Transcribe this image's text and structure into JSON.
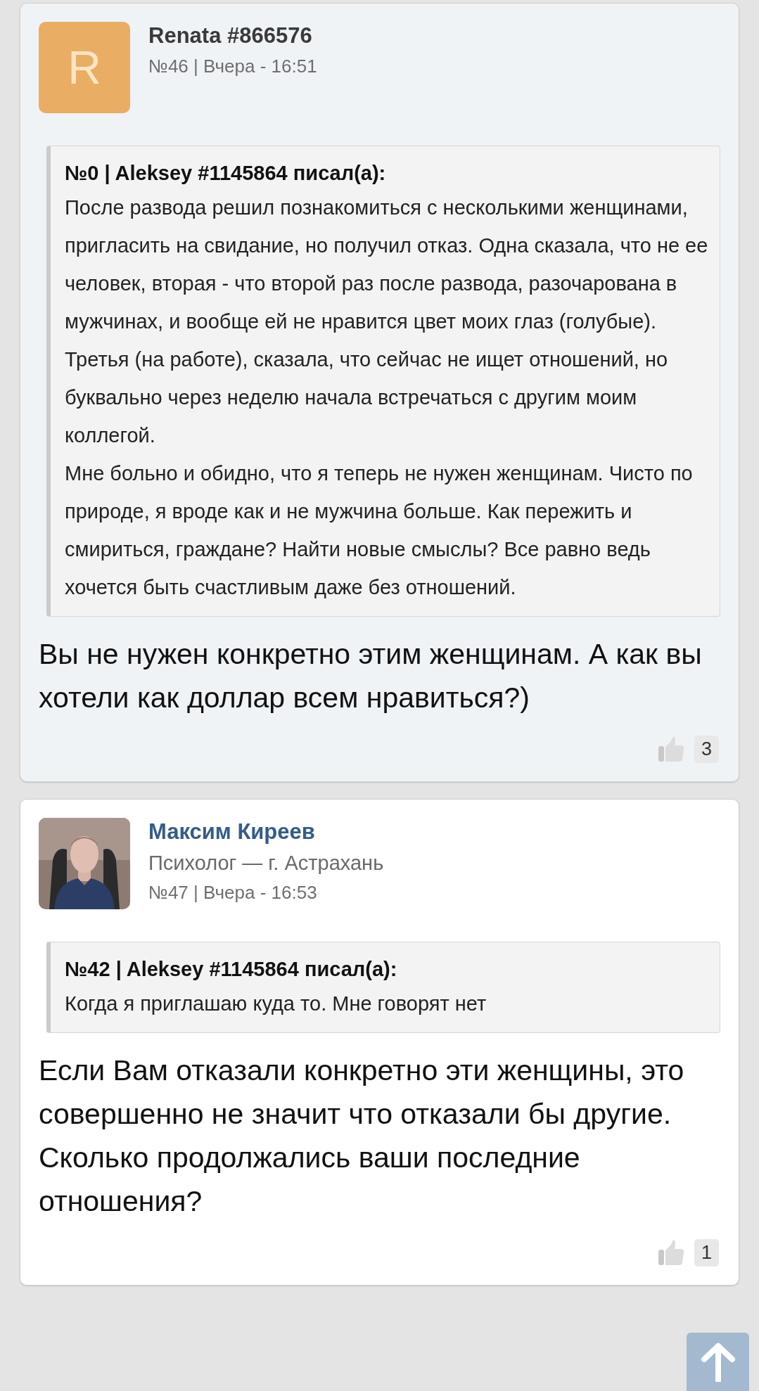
{
  "posts": [
    {
      "highlighted": true,
      "name_is_link": false,
      "avatar": {
        "kind": "letter",
        "letter": "R"
      },
      "name": "Renata #866576",
      "meta": "№46 | Вчера - 16:51",
      "quote": {
        "header": "№0 | Aleksey #1145864 писал(а):",
        "paragraphs": [
          "После развода решил познакомиться с несколькими женщинами, пригласить на свидание, но получил отказ. Одна сказала, что не ее человек, вторая - что второй раз после развода, разочарована в мужчинах, и вообще ей не нравится цвет моих глаз (голубые). Третья (на работе), сказала, что сейчас не ищет отношений, но буквально через неделю начала встречаться с другим моим коллегой.",
          "Мне больно и обидно, что я теперь не нужен женщинам. Чисто по природе, я вроде как и не мужчина больше. Как пережить и смириться, граждане? Найти новые смыслы? Все равно ведь хочется быть счастливым даже без отношений."
        ]
      },
      "body": "Вы не нужен конкретно этим женщинам. А как вы хотели как доллар всем нравиться?)",
      "likes": "3"
    },
    {
      "highlighted": false,
      "name_is_link": true,
      "name": "Максим Киреев",
      "role": "Психолог — г. Астрахань",
      "meta": "№47 | Вчера - 16:53",
      "quote": {
        "header": "№42 | Aleksey #1145864 писал(а):",
        "paragraphs": [
          "Когда я приглашаю куда то. Мне говорят нет"
        ]
      },
      "body": "Если Вам отказали конкретно эти женщины, это совершенно не значит что отказали бы другие. Сколько продолжались ваши последние отношения?",
      "likes": "1"
    }
  ]
}
